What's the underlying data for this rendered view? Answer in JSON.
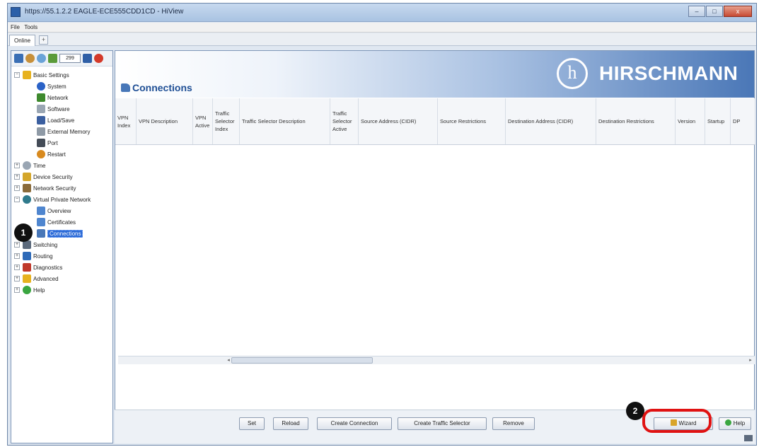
{
  "window": {
    "title": "https://55.1.2.2 EAGLE-ECE555CDD1CD - HiView",
    "controls": [
      "–",
      "□",
      "x"
    ]
  },
  "menubar": {
    "items": [
      "File",
      "Tools"
    ]
  },
  "tabs": {
    "active": "Online",
    "add_label": "+"
  },
  "nav": {
    "toolbar_value": "299",
    "items": [
      {
        "label": "Basic Settings",
        "level": 0,
        "expander": "−",
        "icon": "star-icon",
        "color": "#e7b21e"
      },
      {
        "label": "System",
        "level": 1,
        "icon": "info-icon",
        "color": "#2a62c7"
      },
      {
        "label": "Network",
        "level": 1,
        "icon": "user-network-icon",
        "color": "#3e8a2e"
      },
      {
        "label": "Software",
        "level": 1,
        "icon": "software-icon",
        "color": "#9aa6b3"
      },
      {
        "label": "Load/Save",
        "level": 1,
        "icon": "floppy-icon",
        "color": "#3b5fa0"
      },
      {
        "label": "External Memory",
        "level": 1,
        "icon": "memory-icon",
        "color": "#8f9aa6"
      },
      {
        "label": "Port",
        "level": 1,
        "icon": "port-icon",
        "color": "#444c57"
      },
      {
        "label": "Restart",
        "level": 1,
        "icon": "restart-icon",
        "color": "#d88a1f"
      },
      {
        "label": "Time",
        "level": 0,
        "expander": "+",
        "icon": "clock-icon",
        "color": "#9aa6b3"
      },
      {
        "label": "Device Security",
        "level": 0,
        "expander": "+",
        "icon": "lock-icon",
        "color": "#d4a62a"
      },
      {
        "label": "Network Security",
        "level": 0,
        "expander": "+",
        "icon": "firewall-icon",
        "color": "#8a6b3a"
      },
      {
        "label": "Virtual Private Network",
        "level": 0,
        "expander": "−",
        "icon": "globe-icon",
        "color": "#2f7a8c"
      },
      {
        "label": "Overview",
        "level": 1,
        "icon": "overview-icon",
        "color": "#4f86cf"
      },
      {
        "label": "Certificates",
        "level": 1,
        "icon": "certificate-icon",
        "color": "#4f86cf"
      },
      {
        "label": "Connections",
        "level": 1,
        "icon": "connections-icon",
        "color": "#4877b8",
        "selected": true
      },
      {
        "label": "Switching",
        "level": 0,
        "expander": "+",
        "icon": "switching-icon",
        "color": "#5c6a7c"
      },
      {
        "label": "Routing",
        "level": 0,
        "expander": "+",
        "icon": "routing-icon",
        "color": "#2e6ab8"
      },
      {
        "label": "Diagnostics",
        "level": 0,
        "expander": "+",
        "icon": "diagnostics-icon",
        "color": "#c0392b"
      },
      {
        "label": "Advanced",
        "level": 0,
        "expander": "+",
        "icon": "advanced-star-icon",
        "color": "#e7b21e"
      },
      {
        "label": "Help",
        "level": 0,
        "expander": "+",
        "icon": "help-icon",
        "color": "#3aa640"
      }
    ]
  },
  "page": {
    "title": "Connections",
    "brand": "HIRSCHMANN",
    "brand_mark": "h"
  },
  "table": {
    "columns": [
      "VPN Index",
      "VPN Description",
      "VPN Active",
      "Traffic Selector Index",
      "Traffic Selector Description",
      "Traffic Selector Active",
      "Source Address (CIDR)",
      "Source Restrictions",
      "Destination Address (CIDR)",
      "Destination Restrictions",
      "Version",
      "Startup",
      "DP"
    ],
    "rows": []
  },
  "buttons": {
    "set": "Set",
    "reload": "Reload",
    "create_connection": "Create Connection",
    "create_traffic_selector": "Create Traffic Selector",
    "remove": "Remove",
    "wizard": "Wizard",
    "help": "Help"
  },
  "annotations": {
    "callout_1": "1",
    "callout_2": "2",
    "highlight_color": "#e01212"
  }
}
